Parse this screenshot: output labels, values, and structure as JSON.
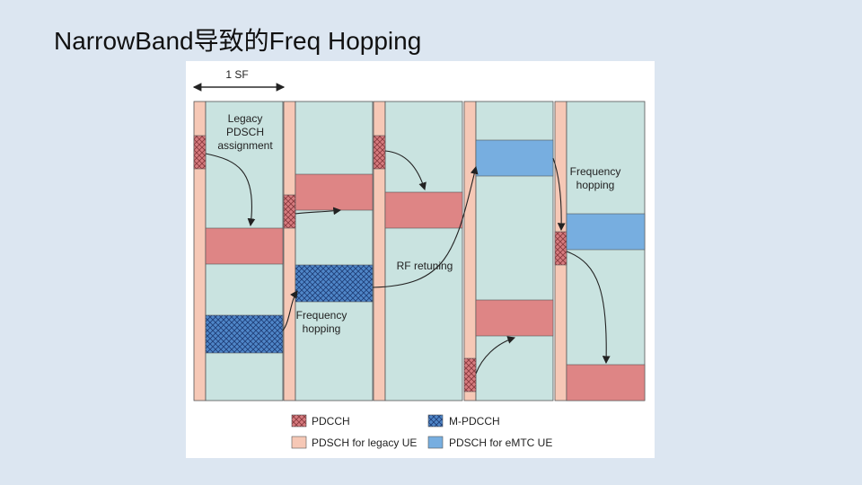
{
  "slide": {
    "title": "NarrowBand导致的Freq Hopping"
  },
  "diagram": {
    "subframe_label": "1 SF",
    "annotations": {
      "legacy_assignment": [
        "Legacy",
        "PDSCH",
        "assignment"
      ],
      "frequency_hopping_1": [
        "Frequency",
        "hopping"
      ],
      "rf_retuning": "RF retuning",
      "frequency_hopping_2": [
        "Frequency",
        "hopping"
      ]
    },
    "legend": {
      "pdcch": "PDCCH",
      "mpdcch": "M-PDCCH",
      "pdsch_legacy": "PDSCH for legacy UE",
      "pdsch_emtc": "PDSCH for eMTC UE"
    },
    "colors": {
      "background": "#dce6f1",
      "narrowband": "#c9e3e0",
      "control_region": "#f6c8b6",
      "pdsch_legacy": "#de8585",
      "pdsch_emtc": "#77aee0",
      "pdcch": "#d77b7f",
      "mpdcch": "#4f86c8"
    }
  }
}
